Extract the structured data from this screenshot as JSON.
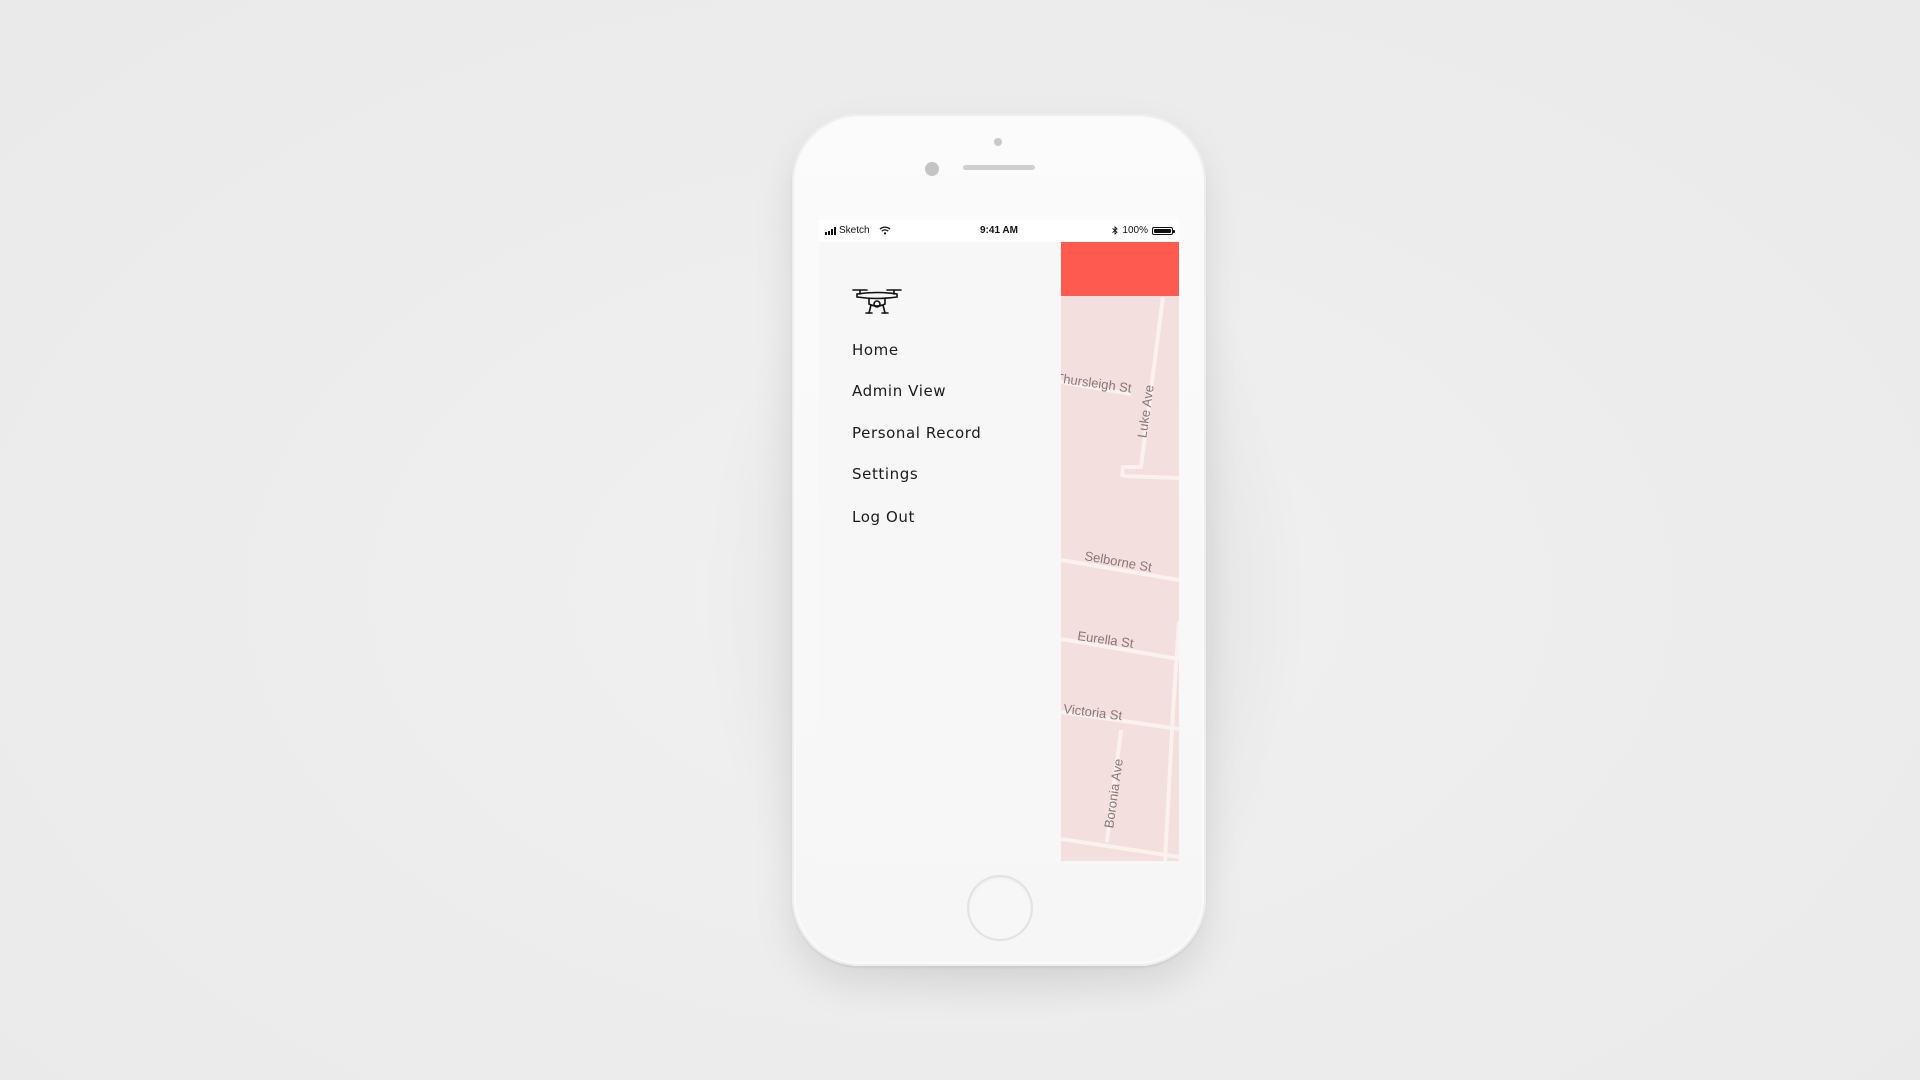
{
  "status_bar": {
    "carrier": "Sketch",
    "time": "9:41 AM",
    "battery_percent": "100%",
    "battery_level": 1.0,
    "icons": [
      "signal-icon",
      "wifi-icon",
      "bluetooth-icon",
      "battery-icon"
    ]
  },
  "drawer": {
    "logo_icon": "drone-icon",
    "menu": [
      {
        "label": "Home"
      },
      {
        "label": "Admin View"
      },
      {
        "label": "Personal Record"
      },
      {
        "label": "Settings"
      },
      {
        "label": "Log Out"
      }
    ]
  },
  "map": {
    "header_color": "#ff5a4f",
    "background_color": "#f3dfdd",
    "streets": {
      "luke": "Luke Ave",
      "thursleigh": "Thursleigh St",
      "selborne": "Selborne St",
      "eurella": "Eurella St",
      "victoria": "Victoria St",
      "boronia": "Boronia Ave"
    }
  },
  "colors": {
    "page_background": "#eeeeee",
    "drawer_background": "#f7f7f7",
    "accent": "#ff5a4f"
  }
}
